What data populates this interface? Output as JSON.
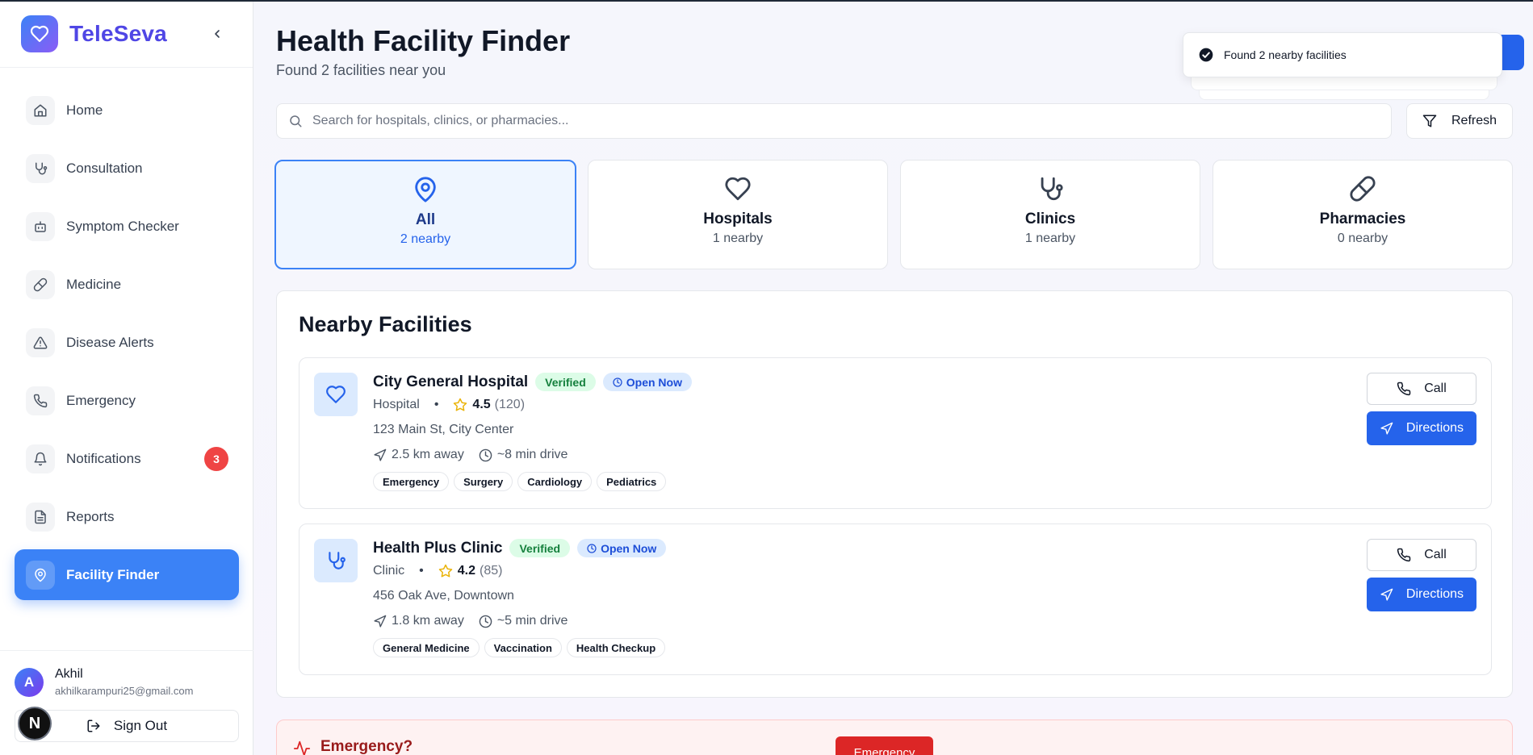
{
  "app": {
    "name": "TeleSeva"
  },
  "nav": {
    "items": [
      {
        "label": "Home",
        "icon": "home-icon"
      },
      {
        "label": "Consultation",
        "icon": "stethoscope-icon"
      },
      {
        "label": "Symptom Checker",
        "icon": "bot-icon"
      },
      {
        "label": "Medicine",
        "icon": "pill-icon"
      },
      {
        "label": "Disease Alerts",
        "icon": "alert-triangle-icon"
      },
      {
        "label": "Emergency",
        "icon": "phone-icon"
      },
      {
        "label": "Notifications",
        "icon": "bell-icon",
        "badge": "3"
      },
      {
        "label": "Reports",
        "icon": "file-text-icon"
      },
      {
        "label": "Facility Finder",
        "icon": "map-pin-icon",
        "active": true
      }
    ]
  },
  "user": {
    "initial": "A",
    "name": "Akhil",
    "email": "akhilkarampuri25@gmail.com",
    "signout_label": "Sign Out",
    "dev_badge": "N"
  },
  "header": {
    "title": "Health Facility Finder",
    "subtitle": "Found 2 facilities near you"
  },
  "toast": {
    "message": "Found 2 nearby facilities"
  },
  "search": {
    "placeholder": "Search for hospitals, clinics, or pharmacies...",
    "value": ""
  },
  "refresh_label": "Refresh",
  "categories": [
    {
      "name": "All",
      "count": "2 nearby",
      "icon": "map-pin-icon",
      "active": true
    },
    {
      "name": "Hospitals",
      "count": "1 nearby",
      "icon": "heart-icon"
    },
    {
      "name": "Clinics",
      "count": "1 nearby",
      "icon": "stethoscope-icon"
    },
    {
      "name": "Pharmacies",
      "count": "0 nearby",
      "icon": "pill-icon"
    }
  ],
  "facilities_section": {
    "title": "Nearby Facilities",
    "items": [
      {
        "name": "City General Hospital",
        "icon": "heart-icon",
        "verified": "Verified",
        "status": "Open Now",
        "type": "Hospital",
        "rating": "4.5",
        "reviews": "(120)",
        "address": "123 Main St, City Center",
        "distance": "2.5 km away",
        "drive": "~8 min drive",
        "tags": [
          "Emergency",
          "Surgery",
          "Cardiology",
          "Pediatrics"
        ],
        "call_label": "Call",
        "directions_label": "Directions"
      },
      {
        "name": "Health Plus Clinic",
        "icon": "stethoscope-icon",
        "verified": "Verified",
        "status": "Open Now",
        "type": "Clinic",
        "rating": "4.2",
        "reviews": "(85)",
        "address": "456 Oak Ave, Downtown",
        "distance": "1.8 km away",
        "drive": "~5 min drive",
        "tags": [
          "General Medicine",
          "Vaccination",
          "Health Checkup"
        ],
        "call_label": "Call",
        "directions_label": "Directions"
      }
    ]
  },
  "emergency_banner": {
    "title": "Emergency?",
    "button_label": "Emergency"
  },
  "colors": {
    "accent": "#3b82f6",
    "primary_button": "#2563eb",
    "brand_text": "#4f46e5",
    "danger": "#dc2626",
    "verified_bg": "#dcfce7",
    "open_bg": "#dbeafe"
  }
}
